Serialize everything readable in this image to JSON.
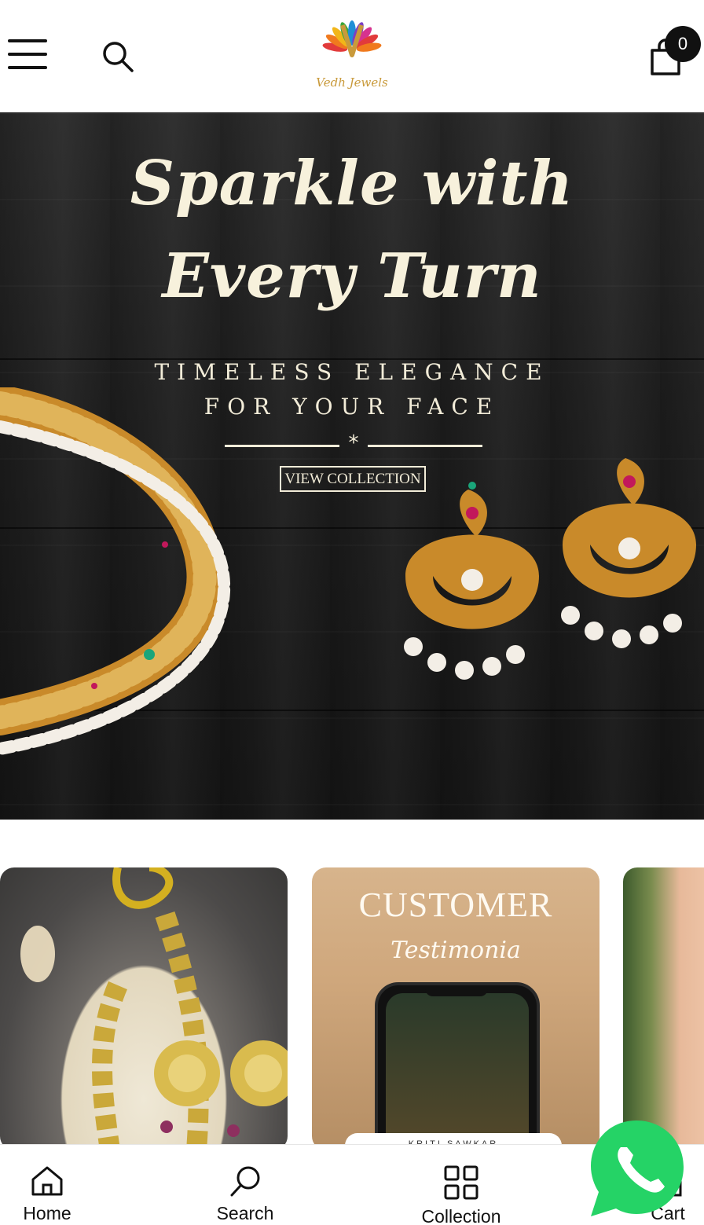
{
  "header": {
    "logo_text": "Vedh Jewels",
    "cart_count": "0"
  },
  "hero": {
    "title_line1": "Sparkle with",
    "title_line2": "Every Turn",
    "subtitle_line1": "TIMELESS ELEGANCE",
    "subtitle_line2": "FOR YOUR FACE",
    "divider_glyph": "*",
    "cta_label": "VIEW COLLECTION"
  },
  "cards": {
    "testimonial_title": "CUSTOMER",
    "testimonial_script": "Testimonia",
    "testimonial_caption": "KRITI SAWKAR"
  },
  "bottom_nav": {
    "items": [
      {
        "label": "Home",
        "icon": "home-icon"
      },
      {
        "label": "Search",
        "icon": "search-icon"
      },
      {
        "label": "Collection",
        "icon": "grid-icon"
      },
      {
        "label": "Cart",
        "icon": "cart-icon"
      }
    ]
  },
  "colors": {
    "hero_text": "#f7f1dc",
    "logo_gold": "#c99a3b",
    "whatsapp_green": "#25d366"
  }
}
